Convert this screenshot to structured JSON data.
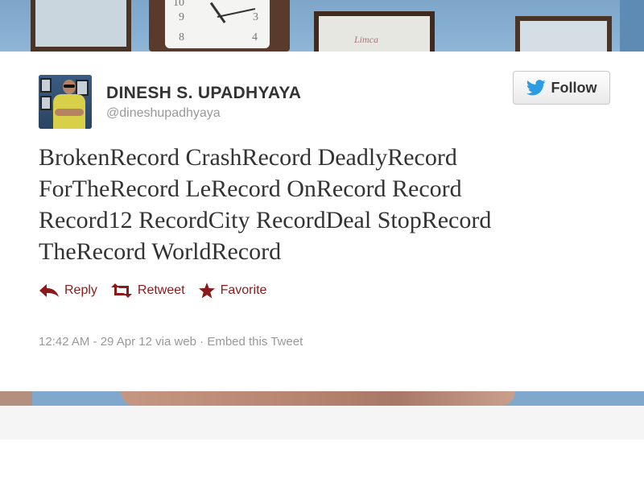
{
  "profile": {
    "name": "DINESH S. UPADHYAYA",
    "handle": "@dineshupadhyaya"
  },
  "follow_button": {
    "label": "Follow",
    "icon": "twitter-bird-icon"
  },
  "tweet": {
    "lines": [
      "BrokenRecord CrashRecord DeadlyRecord",
      "ForTheRecord LeRecord OnRecord Record",
      "Record12 RecordCity RecordDeal StopRecord",
      "TheRecord WorldRecord"
    ]
  },
  "actions": {
    "reply": {
      "label": "Reply",
      "icon": "reply-arrow-icon"
    },
    "retweet": {
      "label": "Retweet",
      "icon": "retweet-icon"
    },
    "favorite": {
      "label": "Favorite",
      "icon": "star-icon"
    }
  },
  "meta": {
    "timestamp": "12:42 AM - 29 Apr 12",
    "via": "via web",
    "separator": "·",
    "embed": "Embed this Tweet"
  },
  "background": {
    "clock_numbers": [
      "10",
      "9",
      "8",
      "3",
      "4"
    ],
    "frame_label": "Limca"
  },
  "colors": {
    "action_red": "#8a1a1a",
    "text": "#333333",
    "muted": "#999999",
    "twitter_blue": "#2b9ce3"
  }
}
